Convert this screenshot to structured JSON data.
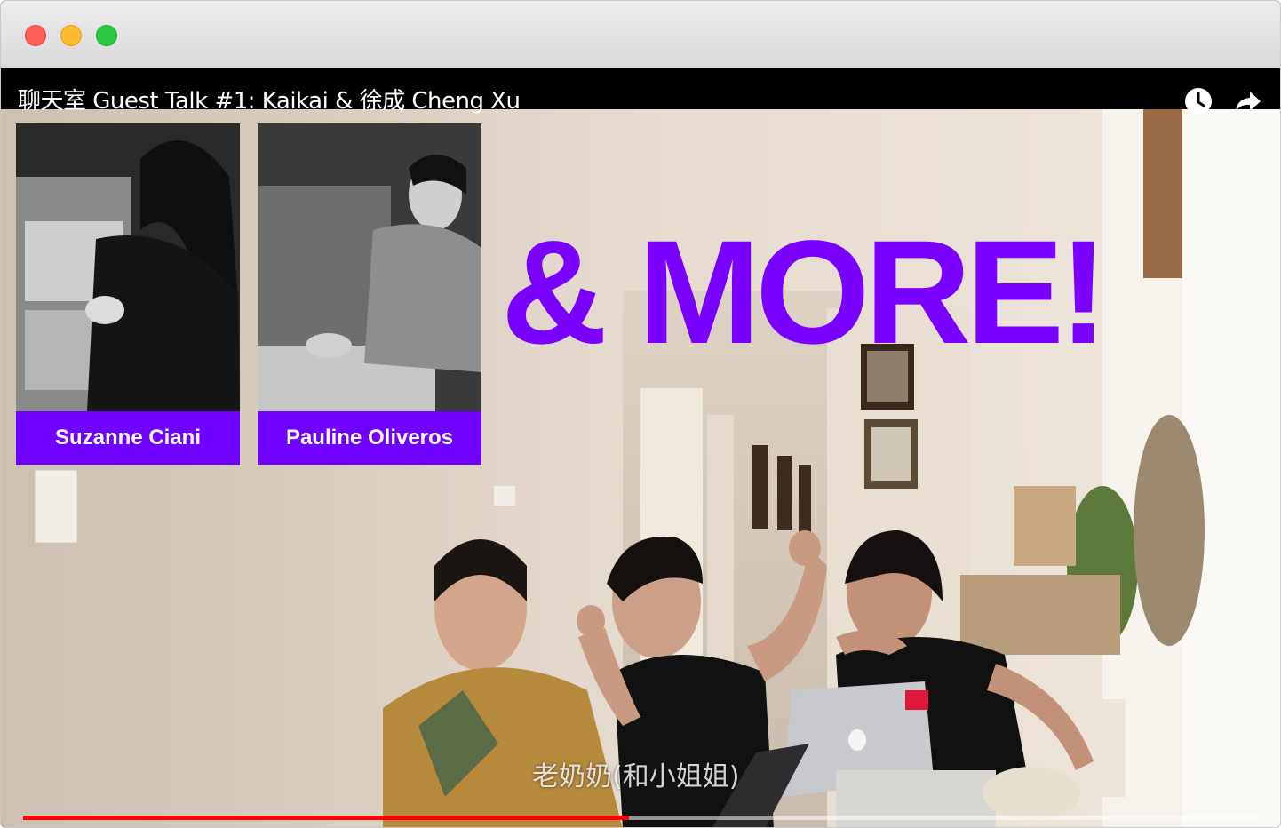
{
  "window": {
    "buttons": [
      "close",
      "minimize",
      "zoom"
    ]
  },
  "video": {
    "title": "聊天室 Guest Talk #1: Kaikai & 徐成 Cheng Xu",
    "controls": {
      "watch_later_icon": "clock-icon",
      "share_icon": "share-arrow-icon"
    },
    "overlay": {
      "cards": [
        {
          "name": "Suzanne Ciani"
        },
        {
          "name": "Pauline Oliveros"
        }
      ],
      "headline": "& MORE!",
      "headline_color": "#7a00ff",
      "card_color": "#7000ff"
    },
    "subtitle": "老奶奶(和小姐姐)",
    "progress": 0.49,
    "progress_color": "#ff0000"
  }
}
